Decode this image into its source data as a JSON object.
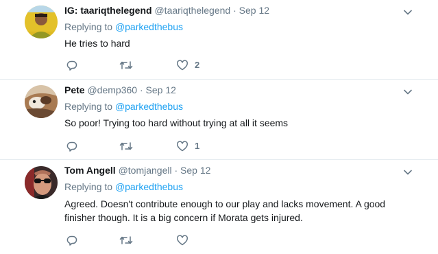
{
  "tweets": [
    {
      "fullname": "IG: taariqthelegend",
      "screenname": "@taariqthelegend",
      "separator": "·",
      "timestamp": "Sep 12",
      "replying_prefix": "Replying to",
      "replying_to": "@parkedthebus",
      "text": "He tries to hard",
      "like_count": "2",
      "avatar_colors": [
        "#e8c21b",
        "#2f6e2c"
      ]
    },
    {
      "fullname": "Pete",
      "screenname": "@demp360",
      "separator": "·",
      "timestamp": "Sep 12",
      "replying_prefix": "Replying to",
      "replying_to": "@parkedthebus",
      "text": "So poor! Trying too hard without trying at all it seems",
      "like_count": "1",
      "avatar_colors": [
        "#c7a27a",
        "#6b4a33"
      ]
    },
    {
      "fullname": "Tom Angell",
      "screenname": "@tomjangell",
      "separator": "·",
      "timestamp": "Sep 12",
      "replying_prefix": "Replying to",
      "replying_to": "@parkedthebus",
      "text": "Agreed. Doesn't contribute enough to our play and lacks movement. A good finisher though. It is a big concern if Morata gets injured.",
      "like_count": "",
      "avatar_colors": [
        "#c9826a",
        "#1b1b1b"
      ]
    }
  ],
  "colors": {
    "link": "#1da1f2",
    "secondary": "#657786",
    "text": "#14171a",
    "divider": "#e6ecf0"
  },
  "icons": [
    "chevron-down-icon",
    "reply-icon",
    "retweet-icon",
    "heart-icon"
  ]
}
